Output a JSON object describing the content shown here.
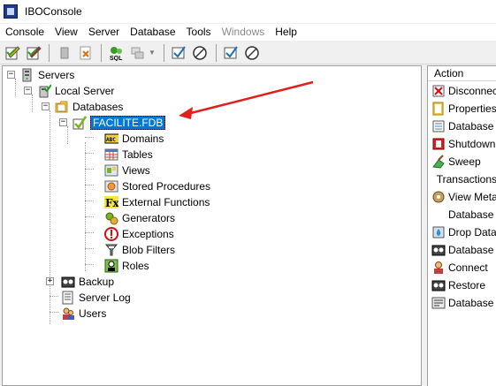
{
  "window": {
    "title": "IBOConsole"
  },
  "menu": {
    "items": [
      {
        "label": "Console",
        "enabled": true
      },
      {
        "label": "View",
        "enabled": true
      },
      {
        "label": "Server",
        "enabled": true
      },
      {
        "label": "Database",
        "enabled": true
      },
      {
        "label": "Tools",
        "enabled": true
      },
      {
        "label": "Windows",
        "enabled": false
      },
      {
        "label": "Help",
        "enabled": true
      }
    ]
  },
  "toolbar": {
    "buttons": [
      "register-server-icon",
      "register-database-icon",
      "delete-icon",
      "unregister-icon",
      "sql-icon",
      "window-stack-icon",
      "check-icon",
      "connect-icon",
      "check-icon",
      "connect-icon"
    ]
  },
  "tree": {
    "servers": {
      "label": "Servers",
      "expander": "−"
    },
    "local_server": {
      "label": "Local Server",
      "expander": "−"
    },
    "databases": {
      "label": "Databases",
      "expander": "−"
    },
    "database": {
      "label": "FACILITE.FDB",
      "expander": "−",
      "selected": true
    },
    "children": [
      {
        "label": "Domains",
        "icon": "domains-icon"
      },
      {
        "label": "Tables",
        "icon": "tables-icon"
      },
      {
        "label": "Views",
        "icon": "views-icon"
      },
      {
        "label": "Stored Procedures",
        "icon": "stored-procedures-icon"
      },
      {
        "label": "External Functions",
        "icon": "external-functions-icon"
      },
      {
        "label": "Generators",
        "icon": "generators-icon"
      },
      {
        "label": "Exceptions",
        "icon": "exceptions-icon"
      },
      {
        "label": "Blob Filters",
        "icon": "blob-filters-icon"
      },
      {
        "label": "Roles",
        "icon": "roles-icon"
      }
    ],
    "backup": {
      "label": "Backup",
      "expander": "+"
    },
    "server_log": {
      "label": "Server Log"
    },
    "users": {
      "label": "Users"
    }
  },
  "action_panel": {
    "header": "Action",
    "items": [
      {
        "label": "Disconnect",
        "icon": "disconnect-icon"
      },
      {
        "label": "Properties",
        "icon": "properties-icon"
      },
      {
        "label": "Database",
        "icon": "database-icon"
      },
      {
        "label": "Shutdown",
        "icon": "shutdown-icon"
      },
      {
        "label": "Sweep",
        "icon": "sweep-icon"
      },
      {
        "label": "Transactions",
        "icon": ""
      },
      {
        "label": "View Metadata",
        "icon": "view-metadata-icon"
      },
      {
        "label": "Database",
        "icon": ""
      },
      {
        "label": "Drop Database",
        "icon": "drop-database-icon"
      },
      {
        "label": "Database",
        "icon": "database-backup-icon"
      },
      {
        "label": "Connect",
        "icon": "connect-user-icon"
      },
      {
        "label": "Restore",
        "icon": "restore-icon"
      },
      {
        "label": "Database",
        "icon": "database-stats-icon"
      }
    ]
  },
  "colors": {
    "selection": "#0078d7",
    "annotation_arrow": "#e0201b"
  }
}
